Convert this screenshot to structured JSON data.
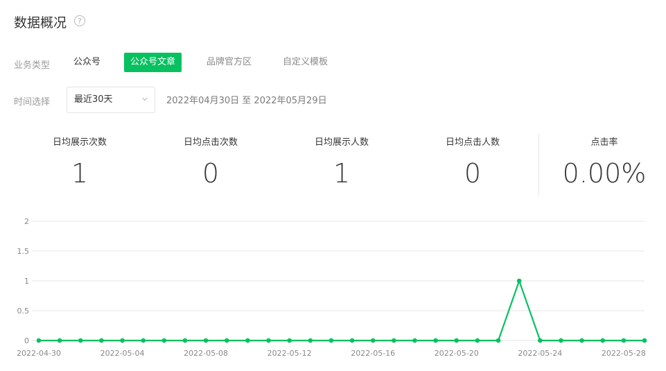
{
  "header": {
    "title": "数据概况",
    "help_glyph": "?"
  },
  "filters": {
    "business_type_label": "业务类型",
    "business_types": [
      "公众号",
      "公众号文章",
      "品牌官方区",
      "自定义模板"
    ],
    "active_business_type": "公众号文章",
    "time_label": "时间选择",
    "time_select_value": "最近30天",
    "date_range": "2022年04月30日 至 2022年05月29日"
  },
  "metrics": [
    {
      "label": "日均展示次数",
      "value": "1"
    },
    {
      "label": "日均点击次数",
      "value": "0"
    },
    {
      "label": "日均展示人数",
      "value": "1"
    },
    {
      "label": "日均点击人数",
      "value": "0"
    },
    {
      "label": "点击率",
      "value": "0.00%"
    }
  ],
  "colors": {
    "accent": "#07c160",
    "grid": "#e5e5e5",
    "axis_text": "#888888"
  },
  "chart_data": {
    "type": "line",
    "x": [
      "2022-04-30",
      "2022-05-01",
      "2022-05-02",
      "2022-05-03",
      "2022-05-04",
      "2022-05-05",
      "2022-05-06",
      "2022-05-07",
      "2022-05-08",
      "2022-05-09",
      "2022-05-10",
      "2022-05-11",
      "2022-05-12",
      "2022-05-13",
      "2022-05-14",
      "2022-05-15",
      "2022-05-16",
      "2022-05-17",
      "2022-05-18",
      "2022-05-19",
      "2022-05-20",
      "2022-05-21",
      "2022-05-22",
      "2022-05-23",
      "2022-05-24",
      "2022-05-25",
      "2022-05-26",
      "2022-05-27",
      "2022-05-28",
      "2022-05-29"
    ],
    "series": [
      {
        "values": [
          0,
          0,
          0,
          0,
          0,
          0,
          0,
          0,
          0,
          0,
          0,
          0,
          0,
          0,
          0,
          0,
          0,
          0,
          0,
          0,
          0,
          0,
          0,
          1,
          0,
          0,
          0,
          0,
          0,
          0
        ]
      }
    ],
    "x_tick_labels": [
      "2022-04-30",
      "2022-05-04",
      "2022-05-08",
      "2022-05-12",
      "2022-05-16",
      "2022-05-20",
      "2022-05-24",
      "2022-05-28"
    ],
    "y_ticks": [
      "0",
      "0.5",
      "1",
      "1.5",
      "2"
    ],
    "ylim": [
      0,
      2
    ],
    "grid": true
  }
}
